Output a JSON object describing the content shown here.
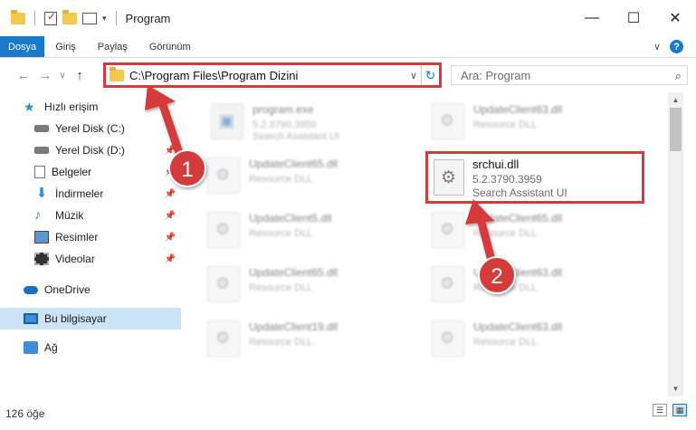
{
  "window": {
    "title": "Program",
    "minimize_glyph": "—",
    "maximize_glyph": "☐",
    "close_glyph": "✕"
  },
  "ribbon": {
    "tabs": [
      {
        "label": "Dosya",
        "active": true
      },
      {
        "label": "Giriş",
        "active": false
      },
      {
        "label": "Paylaş",
        "active": false
      },
      {
        "label": "Görünüm",
        "active": false
      }
    ],
    "expand_glyph": "∨",
    "help_glyph": "?"
  },
  "nav": {
    "back_glyph": "←",
    "forward_glyph": "→",
    "recent_glyph": "∨",
    "up_glyph": "↑",
    "address": "C:\\Program Files\\Program Dizini",
    "address_dropdown_glyph": "∨",
    "refresh_glyph": "↻",
    "search_placeholder": "Ara: Program",
    "search_glyph": "⌕"
  },
  "sidebar": {
    "items": [
      {
        "label": "Hızlı erişim",
        "icon": "star-icon"
      },
      {
        "label": "Yerel Disk (C:)",
        "icon": "drive-icon"
      },
      {
        "label": "Yerel Disk (D:)",
        "icon": "drive-icon"
      },
      {
        "label": "Belgeler",
        "icon": "documents-icon"
      },
      {
        "label": "İndirmeler",
        "icon": "downloads-icon"
      },
      {
        "label": "Müzik",
        "icon": "music-icon"
      },
      {
        "label": "Resimler",
        "icon": "pictures-icon"
      },
      {
        "label": "Videolar",
        "icon": "videos-icon"
      },
      {
        "label": "OneDrive",
        "icon": "cloud-icon"
      },
      {
        "label": "Bu bilgisayar",
        "icon": "computer-icon"
      },
      {
        "label": "Ağ",
        "icon": "network-icon"
      }
    ],
    "pin_glyph": "📌"
  },
  "files": [
    {
      "name": "program.exe",
      "line2": "5.2.3790.3959",
      "line3": "Search Assistant UI"
    },
    {
      "name": "UpdateClient63.dll",
      "line2": "Resource DLL",
      "line3": ""
    },
    {
      "name": "UpdateClient65.dll",
      "line2": "Resource DLL",
      "line3": ""
    },
    {
      "name": "UpdateClient5.dll",
      "line2": "Resource DLL",
      "line3": ""
    },
    {
      "name": "UpdateClient65.dll",
      "line2": "Resource DLL",
      "line3": ""
    },
    {
      "name": "UpdateClient65.dll",
      "line2": "Resource DLL",
      "line3": ""
    },
    {
      "name": "UpdateClient63.dll",
      "line2": "Resource DLL",
      "line3": ""
    },
    {
      "name": "UpdateClient19.dll",
      "line2": "Resource DLL",
      "line3": ""
    },
    {
      "name": "UpdateClient63.dll",
      "line2": "Resource DLL",
      "line3": ""
    }
  ],
  "highlighted_file": {
    "name": "srchui.dll",
    "version": "5.2.3790.3959",
    "description": "Search Assistant UI"
  },
  "annotations": {
    "badge1": "1",
    "badge2": "2",
    "color": "#d63a3a"
  },
  "status": {
    "item_count": "126 öğe"
  },
  "colors": {
    "accent": "#1979ca",
    "selection": "#cce4f7",
    "highlight_border": "#d63a3a"
  }
}
